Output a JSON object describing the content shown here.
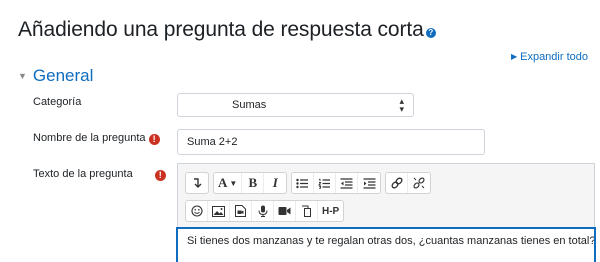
{
  "page": {
    "title": "Añadiendo una pregunta de respuesta corta",
    "expand_all": "Expandir todo"
  },
  "section": {
    "title": "General"
  },
  "form": {
    "category": {
      "label": "Categoría",
      "value": "Sumas"
    },
    "name": {
      "label": "Nombre de la pregunta",
      "value": "Suma 2+2"
    },
    "text": {
      "label": "Texto de la pregunta",
      "content": "Si tienes dos manzanas y te regalan otras dos, ¿cuantas manzanas tienes en total?"
    }
  },
  "toolbar": {
    "font_size": "A",
    "bold": "B",
    "italic": "I",
    "h5p": "H-P"
  },
  "colors": {
    "link": "#0f6cbf",
    "required": "#ca3120",
    "focus_border": "#0f6cbf"
  }
}
